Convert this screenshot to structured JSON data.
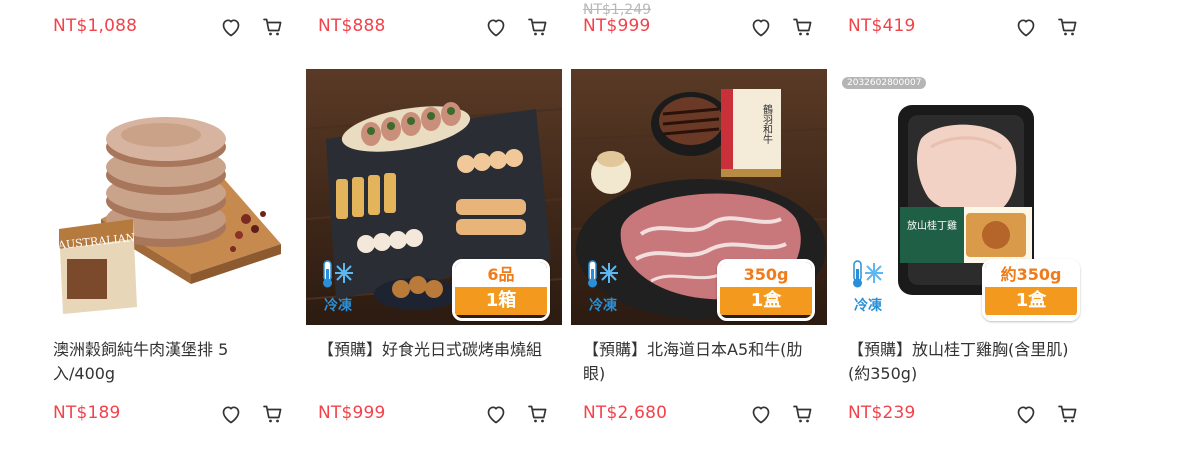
{
  "colors": {
    "price": "#f2434b",
    "strike": "#b8b8b8",
    "icon": "#333333",
    "badge": "#f39a1e",
    "frozen": "#2a8fd6"
  },
  "top_row": [
    {
      "price": "NT$1,088",
      "original_price": ""
    },
    {
      "price": "NT$888",
      "original_price": ""
    },
    {
      "price": "NT$999",
      "original_price": "NT$1,249"
    },
    {
      "price": "NT$419",
      "original_price": ""
    }
  ],
  "products": [
    {
      "title": "澳洲穀飼純牛肉漢堡排 5入/400g",
      "price": "NT$189",
      "image": {
        "package_text": "AUSTRALIAN"
      }
    },
    {
      "title": "【預購】好食光日式碳烤串燒組",
      "price": "NT$999",
      "image": {
        "frozen_label": "冷凍",
        "qty_top": "6品",
        "qty_bottom": "1箱"
      }
    },
    {
      "title": "【預購】北海道日本A5和牛(肋眼)",
      "price": "NT$2,680",
      "image": {
        "frozen_label": "冷凍",
        "qty_top": "350g",
        "qty_bottom": "1盒",
        "box_text": "鶴羽和牛"
      }
    },
    {
      "title": "【預購】放山桂丁雞胸(含里肌)(約350g)",
      "price": "NT$239",
      "image": {
        "sku_tag": "2032602800007",
        "frozen_label": "冷凍",
        "qty_top": "約350g",
        "qty_bottom": "1盒",
        "package_text": "放山桂丁雞"
      }
    }
  ],
  "icons": {
    "favorite": "heart-icon",
    "add_to_cart": "cart-icon"
  }
}
